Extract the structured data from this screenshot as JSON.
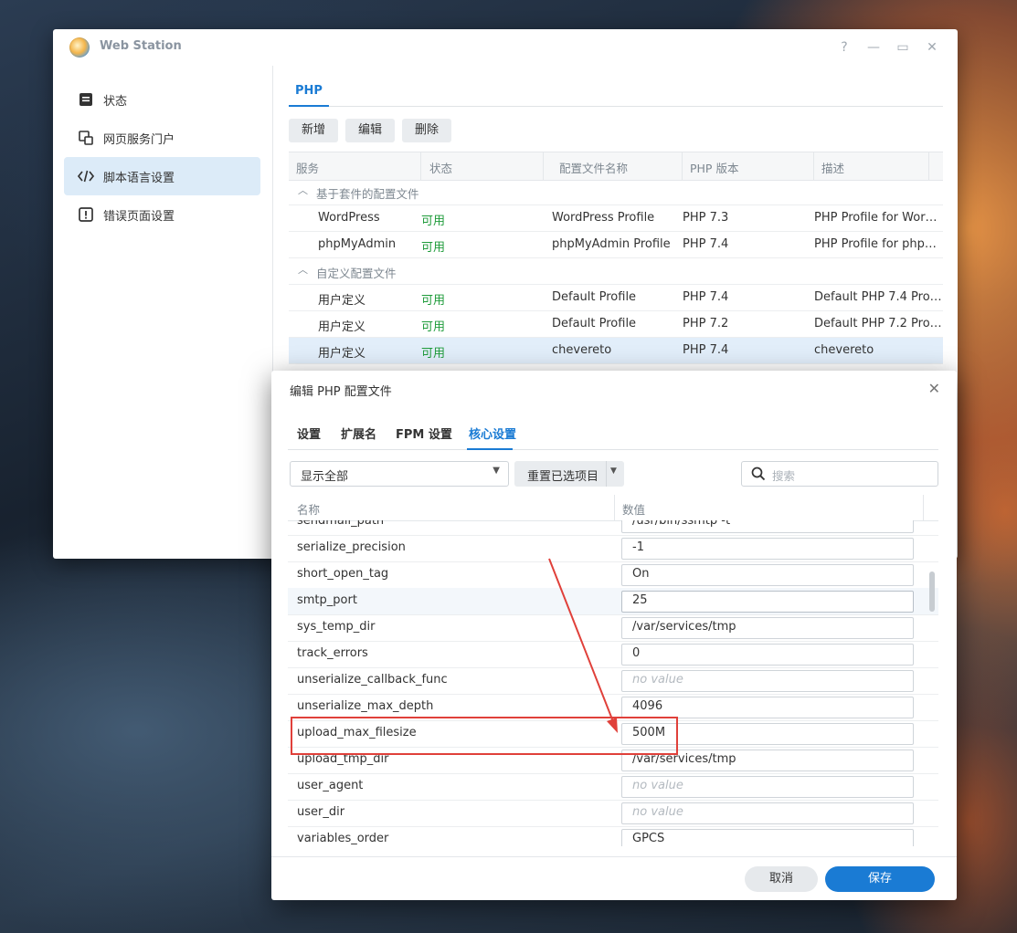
{
  "window": {
    "title": "Web Station",
    "controls": [
      "?",
      "—",
      "▭",
      "✕"
    ]
  },
  "sidebar": {
    "items": [
      {
        "label": "状态",
        "icon": "status-icon",
        "active": false
      },
      {
        "label": "网页服务门户",
        "icon": "portal-icon",
        "active": false
      },
      {
        "label": "脚本语言设置",
        "icon": "code-icon",
        "active": true
      },
      {
        "label": "错误页面设置",
        "icon": "error-icon",
        "active": false
      }
    ]
  },
  "php_panel": {
    "tab": "PHP",
    "toolbar": {
      "add": "新增",
      "edit": "编辑",
      "delete": "删除"
    },
    "columns": [
      "服务",
      "状态",
      "配置文件名称",
      "PHP 版本",
      "描述"
    ],
    "groups": [
      {
        "label": "基于套件的配置文件",
        "rows": [
          {
            "service": "WordPress",
            "status": "可用",
            "profile": "WordPress Profile",
            "version": "PHP 7.3",
            "desc": "PHP Profile for Wor…"
          },
          {
            "service": "phpMyAdmin",
            "status": "可用",
            "profile": "phpMyAdmin Profile",
            "version": "PHP 7.4",
            "desc": "PHP Profile for php…"
          }
        ]
      },
      {
        "label": "自定义配置文件",
        "rows": [
          {
            "service": "用户定义",
            "status": "可用",
            "profile": "Default Profile",
            "version": "PHP 7.4",
            "desc": "Default PHP 7.4 Pro…"
          },
          {
            "service": "用户定义",
            "status": "可用",
            "profile": "Default Profile",
            "version": "PHP 7.2",
            "desc": "Default PHP 7.2 Pro…"
          },
          {
            "service": "用户定义",
            "status": "可用",
            "profile": "chevereto",
            "version": "PHP 7.4",
            "desc": "chevereto"
          }
        ]
      }
    ]
  },
  "dialog": {
    "title": "编辑 PHP 配置文件",
    "close": "✕",
    "tabs": [
      "设置",
      "扩展名",
      "FPM 设置",
      "核心设置"
    ],
    "active_tab": "核心设置",
    "filter_select": "显示全部",
    "reset_button": "重置已选项目",
    "search_placeholder": "搜索",
    "columns": [
      "名称",
      "数值"
    ],
    "rows": [
      {
        "key": "sendmail_path",
        "value": "/usr/bin/ssmtp -t",
        "placeholder": false
      },
      {
        "key": "serialize_precision",
        "value": "-1",
        "placeholder": false
      },
      {
        "key": "short_open_tag",
        "value": "On",
        "placeholder": false
      },
      {
        "key": "smtp_port",
        "value": "25",
        "placeholder": false
      },
      {
        "key": "sys_temp_dir",
        "value": "/var/services/tmp",
        "placeholder": false
      },
      {
        "key": "track_errors",
        "value": "0",
        "placeholder": false
      },
      {
        "key": "unserialize_callback_func",
        "value": "no value",
        "placeholder": true
      },
      {
        "key": "unserialize_max_depth",
        "value": "4096",
        "placeholder": false
      },
      {
        "key": "upload_max_filesize",
        "value": "500M",
        "placeholder": false
      },
      {
        "key": "upload_tmp_dir",
        "value": "/var/services/tmp",
        "placeholder": false
      },
      {
        "key": "user_agent",
        "value": "no value",
        "placeholder": true
      },
      {
        "key": "user_dir",
        "value": "no value",
        "placeholder": true
      },
      {
        "key": "variables_order",
        "value": "GPCS",
        "placeholder": false
      }
    ],
    "cancel": "取消",
    "save": "保存"
  },
  "annotation": {
    "color": "#e0403a"
  }
}
